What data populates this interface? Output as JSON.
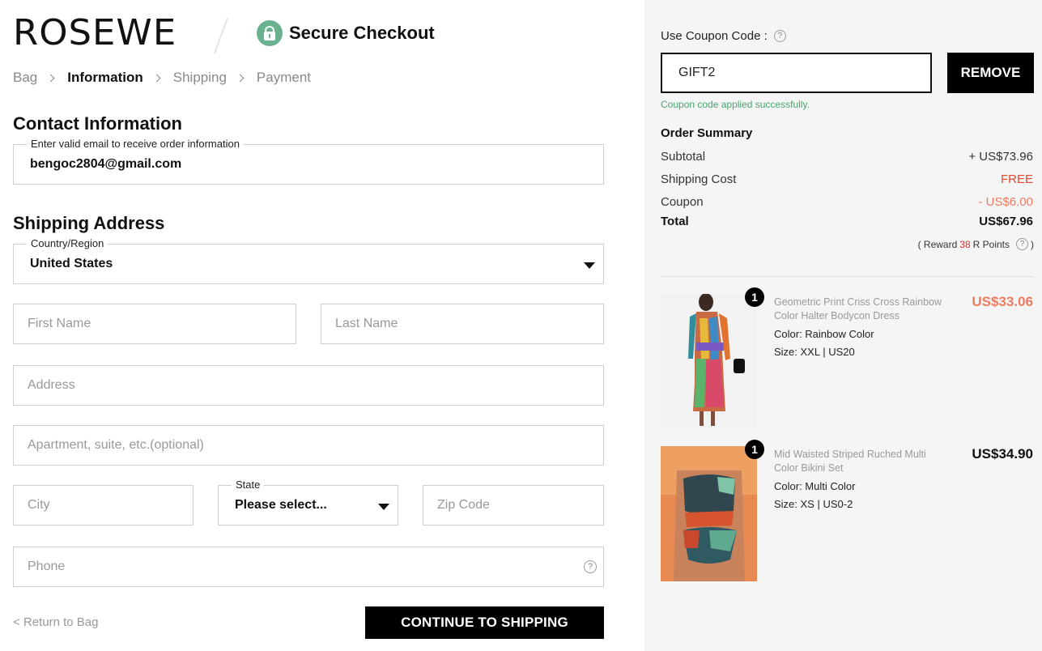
{
  "header": {
    "logo": "ROSEWE",
    "secure_label": "Secure Checkout"
  },
  "breadcrumbs": [
    "Bag",
    "Information",
    "Shipping",
    "Payment"
  ],
  "contact": {
    "title": "Contact Information",
    "email_legend": "Enter valid email to receive order information",
    "email_value": "bengoc2804@gmail.com"
  },
  "shipping": {
    "title": "Shipping Address",
    "country_legend": "Country/Region",
    "country_value": "United States",
    "first_name_ph": "First Name",
    "last_name_ph": "Last Name",
    "address_ph": "Address",
    "apartment_ph": "Apartment, suite, etc.(optional)",
    "city_ph": "City",
    "state_legend": "State",
    "state_value": "Please select...",
    "zip_ph": "Zip Code",
    "phone_ph": "Phone"
  },
  "actions": {
    "return_label": "< Return to Bag",
    "continue_label": "CONTINUE TO SHIPPING"
  },
  "coupon": {
    "label": "Use Coupon Code :",
    "value": "GIFT2",
    "remove_label": "REMOVE",
    "message": "Coupon code applied successfully."
  },
  "summary": {
    "title": "Order Summary",
    "subtotal_label": "Subtotal",
    "subtotal_value": "+ US$73.96",
    "shipping_label": "Shipping Cost",
    "shipping_value": "FREE",
    "coupon_label": "Coupon",
    "coupon_value": "- US$6.00",
    "total_label": "Total",
    "total_value": "US$67.96",
    "reward_prefix": "( Reward",
    "reward_points": "38",
    "reward_suffix": "R Points"
  },
  "items": [
    {
      "qty": "1",
      "name": "Geometric Print Criss Cross Rainbow Color Halter Bodycon Dress",
      "color": "Color: Rainbow Color",
      "size": "Size: XXL | US20",
      "price": "US$33.06"
    },
    {
      "qty": "1",
      "name": "Mid Waisted Striped Ruched Multi Color Bikini Set",
      "color": "Color: Multi Color",
      "size": "Size: XS | US0-2",
      "price": "US$34.90"
    }
  ],
  "colors": {
    "accent_green": "#6ab18f",
    "sale": "#ee7b5f",
    "free": "#e8452e",
    "success": "#4aa36b"
  }
}
